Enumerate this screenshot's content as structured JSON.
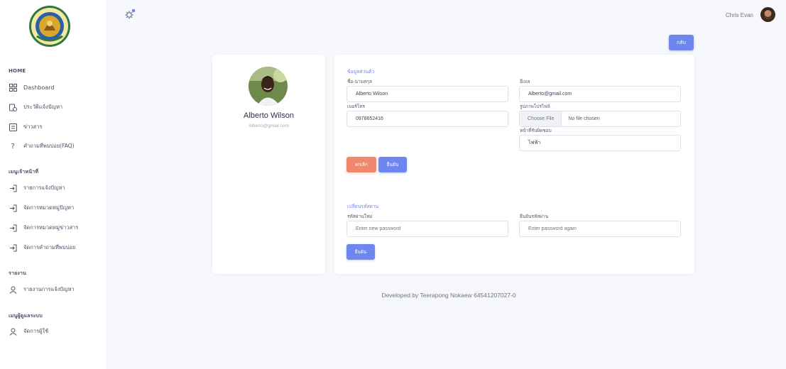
{
  "sidebar": {
    "logo_icon": "organization-seal",
    "sections": {
      "home": "HOME",
      "staff_menu": "เมนูเจ้าหน้าที่",
      "report": "รายงาน",
      "admin_menu": "เมนูผู้ดูแลระบบ"
    },
    "home_items": [
      {
        "label": "Dashboard",
        "icon": "grid-icon"
      },
      {
        "label": "ประวัติแจ้งปัญหา",
        "icon": "history-icon"
      },
      {
        "label": "ข่าวสาร",
        "icon": "news-icon"
      },
      {
        "label": "คำถามที่พบบ่อย(FAQ)",
        "icon": "question-icon"
      }
    ],
    "staff_items": [
      {
        "label": "รายการแจ้งปัญหา",
        "icon": "login-icon"
      },
      {
        "label": "จัดการหมวดหมู่ปัญหา",
        "icon": "login-icon"
      },
      {
        "label": "จัดการหมวดหมู่ข่าวสาร",
        "icon": "login-icon"
      },
      {
        "label": "จัดการคำถามที่พบบ่อย",
        "icon": "login-icon"
      }
    ],
    "report_items": [
      {
        "label": "รายงานการแจ้งปัญหา",
        "icon": "user-icon"
      }
    ],
    "admin_items": [
      {
        "label": "จัดการผู้ใช้",
        "icon": "user-icon"
      }
    ]
  },
  "topbar": {
    "settings_icon": "gear-icon",
    "user_name": "Chris Evan",
    "back_label": "กลับ"
  },
  "profile": {
    "name": "Alberto Wilson",
    "email": "Alberto@gmail.com"
  },
  "personal_form": {
    "heading": "ข้อมูลส่วนตัว",
    "fullname_label": "ชื่อ-นามสกุล",
    "fullname_value": "Alberto Wilson",
    "email_label": "อีเมล",
    "email_value": "Alberto@gmail.com",
    "phone_label": "เบอร์โทร",
    "phone_value": "0978652416",
    "photo_label": "รูปภาพโปรไฟล์",
    "file_button": "Choose File",
    "file_status": "No file chosen",
    "responsibility_label": "หน้าที่รับผิดชอบ",
    "responsibility_value": "ไฟฟ้า",
    "cancel_label": "ยกเลิก",
    "confirm_label": "ยืนยัน"
  },
  "password_form": {
    "heading": "เปลี่ยนรหัสผ่าน",
    "new_label": "รหัสผ่านใหม่",
    "new_placeholder": "Enter new password",
    "confirm_label": "ยืนยันรหัสผ่าน",
    "confirm_placeholder": "Enter password again",
    "submit_label": "ยืนยัน"
  },
  "footer": {
    "text": "Developed by Teerapong Nokaew 64541207027-0"
  },
  "colors": {
    "accent": "#6e86f0",
    "cancel": "#f2876f",
    "background": "#f7f8fb"
  }
}
